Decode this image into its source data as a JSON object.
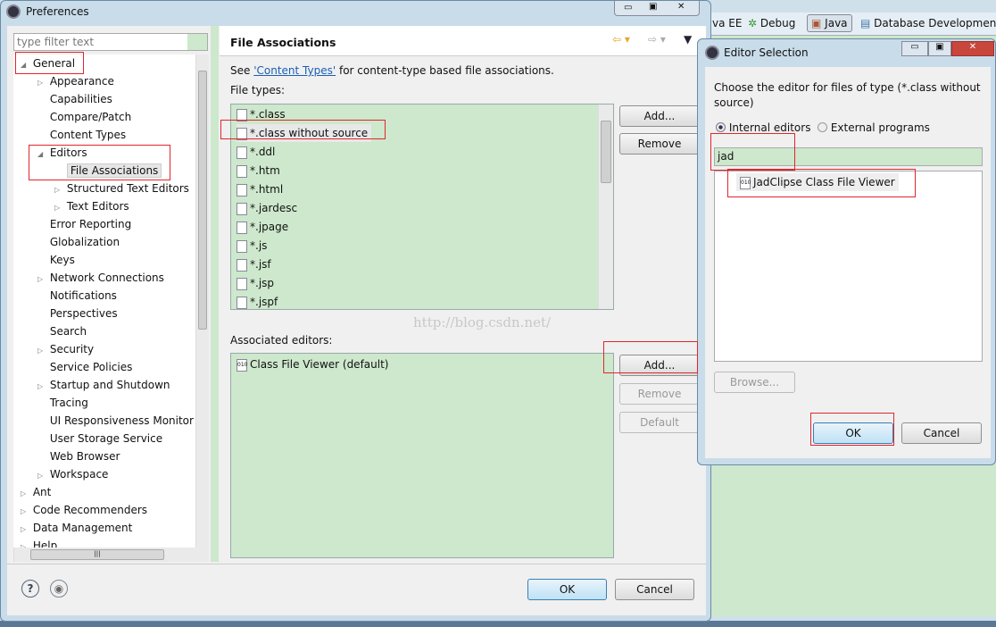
{
  "perspectives": [
    "va EE",
    "Debug",
    "Java",
    "Database Developmen"
  ],
  "prefs": {
    "title": "Preferences",
    "filter_placeholder": "type filter text",
    "tree": [
      {
        "label": "General",
        "level": 0,
        "exp": "open"
      },
      {
        "label": "Appearance",
        "level": 1,
        "exp": "closed"
      },
      {
        "label": "Capabilities",
        "level": 1,
        "exp": ""
      },
      {
        "label": "Compare/Patch",
        "level": 1,
        "exp": ""
      },
      {
        "label": "Content Types",
        "level": 1,
        "exp": ""
      },
      {
        "label": "Editors",
        "level": 1,
        "exp": "open"
      },
      {
        "label": "File Associations",
        "level": 2,
        "exp": "",
        "selected": true
      },
      {
        "label": "Structured Text Editors",
        "level": 2,
        "exp": "closed"
      },
      {
        "label": "Text Editors",
        "level": 2,
        "exp": "closed"
      },
      {
        "label": "Error Reporting",
        "level": 1,
        "exp": ""
      },
      {
        "label": "Globalization",
        "level": 1,
        "exp": ""
      },
      {
        "label": "Keys",
        "level": 1,
        "exp": ""
      },
      {
        "label": "Network Connections",
        "level": 1,
        "exp": "closed"
      },
      {
        "label": "Notifications",
        "level": 1,
        "exp": ""
      },
      {
        "label": "Perspectives",
        "level": 1,
        "exp": ""
      },
      {
        "label": "Search",
        "level": 1,
        "exp": ""
      },
      {
        "label": "Security",
        "level": 1,
        "exp": "closed"
      },
      {
        "label": "Service Policies",
        "level": 1,
        "exp": ""
      },
      {
        "label": "Startup and Shutdown",
        "level": 1,
        "exp": "closed"
      },
      {
        "label": "Tracing",
        "level": 1,
        "exp": ""
      },
      {
        "label": "UI Responsiveness Monitor",
        "level": 1,
        "exp": ""
      },
      {
        "label": "User Storage Service",
        "level": 1,
        "exp": ""
      },
      {
        "label": "Web Browser",
        "level": 1,
        "exp": ""
      },
      {
        "label": "Workspace",
        "level": 1,
        "exp": "closed"
      },
      {
        "label": "Ant",
        "level": 0,
        "exp": "closed"
      },
      {
        "label": "Code Recommenders",
        "level": 0,
        "exp": "closed"
      },
      {
        "label": "Data Management",
        "level": 0,
        "exp": "closed"
      },
      {
        "label": "Help",
        "level": 0,
        "exp": "closed"
      }
    ],
    "page_title": "File Associations",
    "see_prefix": "See ",
    "see_link": "'Content Types'",
    "see_suffix": " for content-type based file associations.",
    "file_types_label": "File types:",
    "file_types": [
      "*.class",
      "*.class without source",
      "*.ddl",
      "*.htm",
      "*.html",
      "*.jardesc",
      "*.jpage",
      "*.js",
      "*.jsf",
      "*.jsp",
      "*.jspf"
    ],
    "selected_file_type": 1,
    "add": "Add...",
    "remove": "Remove",
    "default": "Default",
    "assoc_label": "Associated editors:",
    "assoc_editors": [
      "Class File Viewer (default)"
    ],
    "ok": "OK",
    "cancel": "Cancel",
    "watermark": "http://blog.csdn.net/"
  },
  "editor_sel": {
    "title": "Editor Selection",
    "prompt": "Choose the editor for files of type (*.class without source)",
    "internal": "Internal editors",
    "external": "External programs",
    "filter_value": "jad",
    "results": [
      "JadClipse Class File Viewer"
    ],
    "browse": "Browse...",
    "ok": "OK",
    "cancel": "Cancel"
  }
}
